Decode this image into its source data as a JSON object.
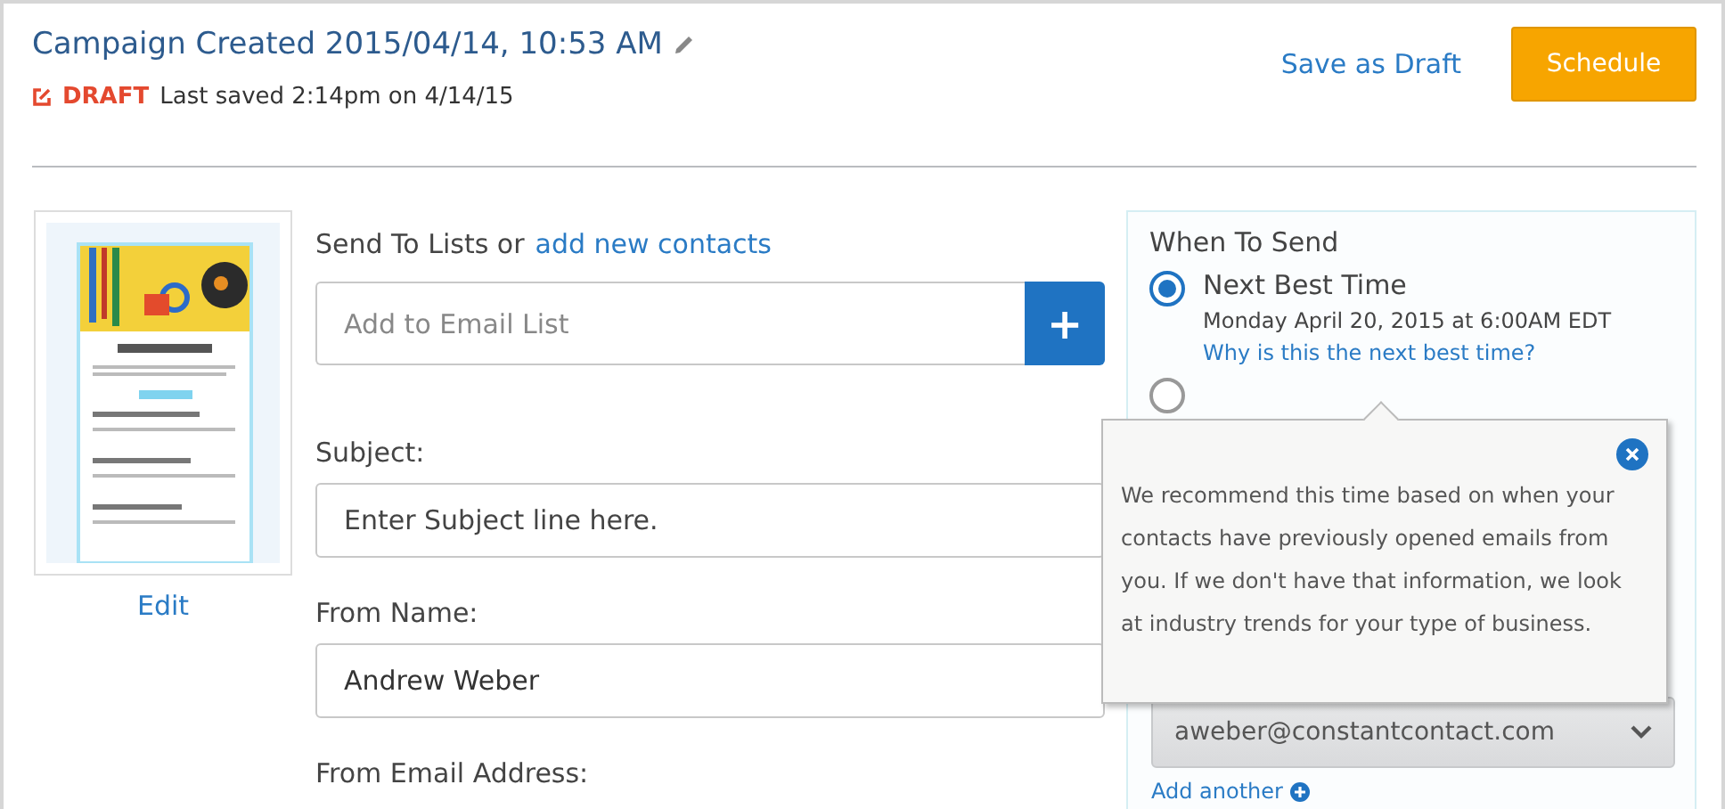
{
  "header": {
    "title": "Campaign Created 2015/04/14, 10:53 AM",
    "status": "DRAFT",
    "last_saved": "Last saved 2:14pm on 4/14/15",
    "save_draft": "Save as Draft",
    "schedule": "Schedule"
  },
  "preview": {
    "kind": "picture",
    "edit": "Edit"
  },
  "form": {
    "lists_label": "Send To Lists or",
    "lists_link": "add new contacts",
    "list_field": {
      "placeholder": "Add to Email List"
    },
    "add_button": "+",
    "fields": [
      {
        "label": "Subject:",
        "placeholder": "Enter Subject line here."
      },
      {
        "label": "From Name:",
        "value": "Andrew Weber"
      }
    ],
    "email_label": "From Email Address:"
  },
  "when": {
    "title": "When To Send",
    "options": [
      {
        "label": "Next Best Time",
        "selected": true,
        "detail": "Monday April 20, 2015 at 6:00AM EDT",
        "link": "Why is this the next best time?"
      },
      {
        "selected": false
      }
    ],
    "email_select": "aweber@constantcontact.com",
    "add_another": "Add another"
  },
  "tooltip": {
    "text": "We recommend this time based on when your contacts have previously opened emails from you. If we don't have that information, we look at industry trends for your type of business."
  }
}
